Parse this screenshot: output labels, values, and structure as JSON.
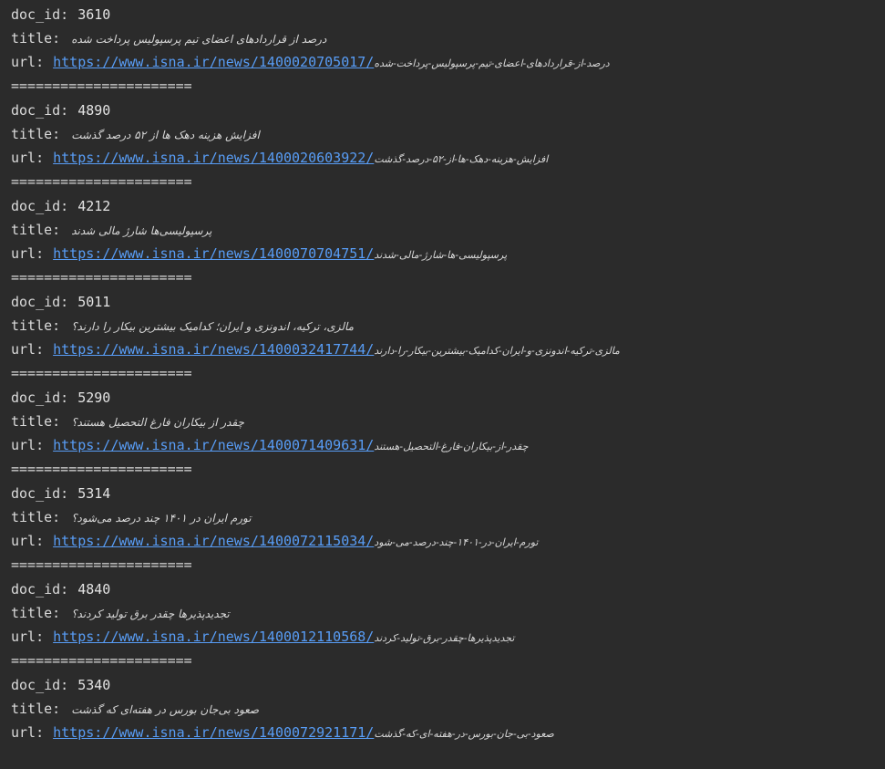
{
  "labels": {
    "doc_id": "doc_id:",
    "title": "title:",
    "url": "url:"
  },
  "separator": "======================",
  "colors": {
    "background": "#2b2b2b",
    "text": "#e3e3e3",
    "link": "#589df6"
  },
  "records": [
    {
      "doc_id": "3610",
      "title": "درصد از قراردادهای اعضای تیم پرسپولیس پرداخت شده",
      "url_link": "https://www.isna.ir/news/1400020705017/",
      "url_slug": "درصد-از-قراردادهای-اعضای-تیم-پرسپولیس-پرداخت-شده"
    },
    {
      "doc_id": "4890",
      "title": "افزایش هزینه دهک ها از ۵۲ درصد گذشت",
      "url_link": "https://www.isna.ir/news/1400020603922/",
      "url_slug": "افزایش-هزینه-دهک-ها-از-۵۲-درصد-گذشت"
    },
    {
      "doc_id": "4212",
      "title": "پرسپولیسی‌ها شارژ مالی شدند",
      "url_link": "https://www.isna.ir/news/1400070704751/",
      "url_slug": "پرسپولیسی-ها-شارژ-مالی-شدند"
    },
    {
      "doc_id": "5011",
      "title": "مالزی، ترکیه، اندونزی و ایران؛ کدامیک بیشترین بیکار را دارند؟",
      "url_link": "https://www.isna.ir/news/1400032417744/",
      "url_slug": "مالزی-ترکیه-اندونزی-و-ایران-کدامیک-بیشترین-بیکار-را-دارند"
    },
    {
      "doc_id": "5290",
      "title": "چقدر از بیکاران فارغ التحصیل هستند؟",
      "url_link": "https://www.isna.ir/news/1400071409631/",
      "url_slug": "چقدر-از-بیکاران-فارغ-التحصیل-هستند"
    },
    {
      "doc_id": "5314",
      "title": "تورم ایران در ۱۴۰۱ چند درصد می‌شود؟",
      "url_link": "https://www.isna.ir/news/1400072115034/",
      "url_slug": "تورم-ایران-در-۱۴۰۱-چند-درصد-می-شود"
    },
    {
      "doc_id": "4840",
      "title": "تجدیدپذیرها چقدر برق تولید کردند؟",
      "url_link": "https://www.isna.ir/news/1400012110568/",
      "url_slug": "تجدیدپذیرها-چقدر-برق-تولید-کردند"
    },
    {
      "doc_id": "5340",
      "title": "صعود بی‌جان بورس در هفته‌ای که گذشت",
      "url_link": "https://www.isna.ir/news/1400072921171/",
      "url_slug": "صعود-بی-جان-بورس-در-هفته-ای-که-گذشت"
    }
  ]
}
